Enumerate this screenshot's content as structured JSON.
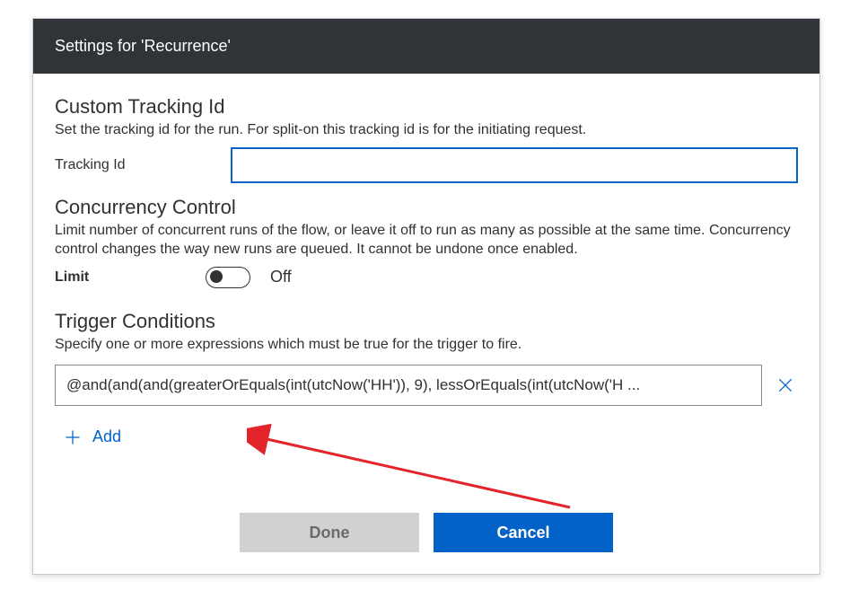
{
  "header": {
    "title": "Settings for 'Recurrence'"
  },
  "tracking": {
    "section_title": "Custom Tracking Id",
    "section_desc": "Set the tracking id for the run. For split-on this tracking id is for the initiating request.",
    "label": "Tracking Id",
    "value": ""
  },
  "concurrency": {
    "section_title": "Concurrency Control",
    "section_desc": "Limit number of concurrent runs of the flow, or leave it off to run as many as possible at the same time. Concurrency control changes the way new runs are queued. It cannot be undone once enabled.",
    "limit_label": "Limit",
    "toggle_state": "Off"
  },
  "conditions": {
    "section_title": "Trigger Conditions",
    "section_desc": "Specify one or more expressions which must be true for the trigger to fire.",
    "items": [
      "@and(and(and(greaterOrEquals(int(utcNow('HH')), 9), lessOrEquals(int(utcNow('H ..."
    ],
    "add_label": "Add"
  },
  "footer": {
    "done_label": "Done",
    "cancel_label": "Cancel"
  }
}
